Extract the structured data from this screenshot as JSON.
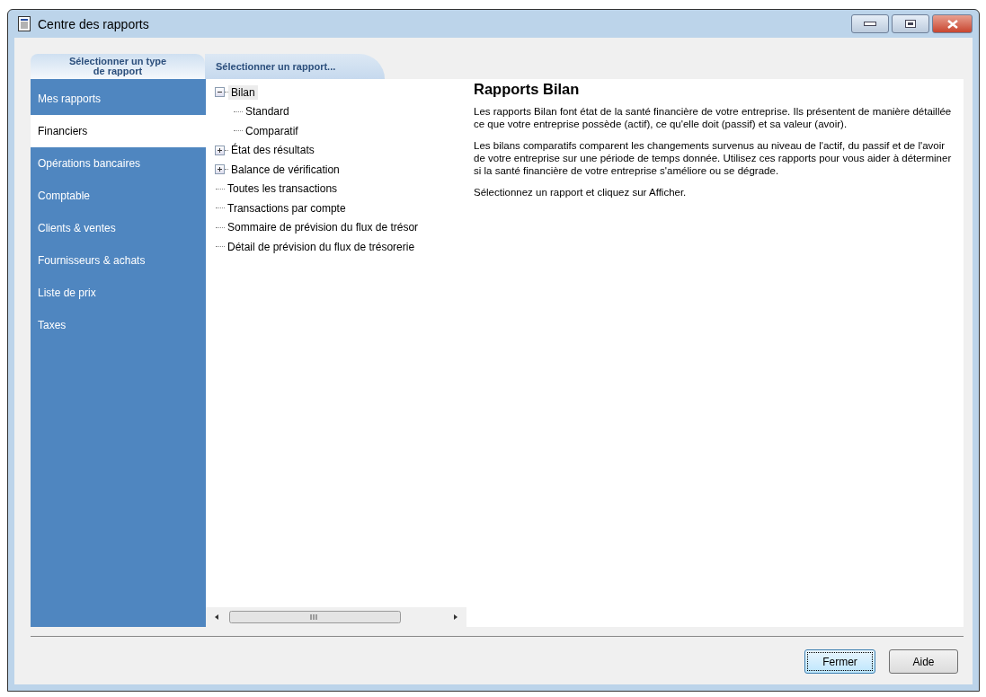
{
  "window": {
    "title": "Centre des rapports"
  },
  "tabs": [
    {
      "label": "Sélectionner un type de rapport",
      "selected": true
    },
    {
      "label": "Sélectionner un rapport...",
      "selected": false
    }
  ],
  "sidebar": {
    "items": [
      {
        "label": "Mes rapports",
        "selected": false
      },
      {
        "label": "Financiers",
        "selected": true
      },
      {
        "label": "Opérations bancaires",
        "selected": false
      },
      {
        "label": "Comptable",
        "selected": false
      },
      {
        "label": "Clients & ventes",
        "selected": false
      },
      {
        "label": "Fournisseurs & achats",
        "selected": false
      },
      {
        "label": "Liste de prix",
        "selected": false
      },
      {
        "label": "Taxes",
        "selected": false
      }
    ]
  },
  "tree": [
    {
      "label": "Bilan",
      "selected": true,
      "expanded": true,
      "children": [
        {
          "label": "Standard",
          "selected": false
        },
        {
          "label": "Comparatif",
          "selected": false
        }
      ]
    },
    {
      "label": "État des résultats",
      "selected": false,
      "expanded": false
    },
    {
      "label": "Balance de vérification",
      "selected": false,
      "expanded": false
    },
    {
      "label": "Toutes les transactions",
      "selected": false
    },
    {
      "label": "Transactions par compte",
      "selected": false
    },
    {
      "label": "Sommaire de prévision du flux de trésor",
      "selected": false
    },
    {
      "label": "Détail de prévision du flux de trésorerie",
      "selected": false
    }
  ],
  "description": {
    "title": "Rapports Bilan",
    "paragraphs": [
      "Les rapports Bilan font état de la santé financière de votre entreprise. Ils présentent de manière détaillée ce que votre entreprise possède (actif), ce qu'elle doit (passif) et sa valeur (avoir).",
      "Les bilans comparatifs comparent les changements survenus au niveau de l'actif, du passif et de l'avoir de votre entreprise sur une période de temps donnée. Utilisez ces rapports pour vous aider à déterminer si la santé financière de votre entreprise s'améliore ou se dégrade.",
      "Sélectionnez un rapport et cliquez sur Afficher."
    ]
  },
  "buttons": [
    {
      "label": "Fermer",
      "focused": true
    },
    {
      "label": "Aide",
      "focused": false
    }
  ]
}
